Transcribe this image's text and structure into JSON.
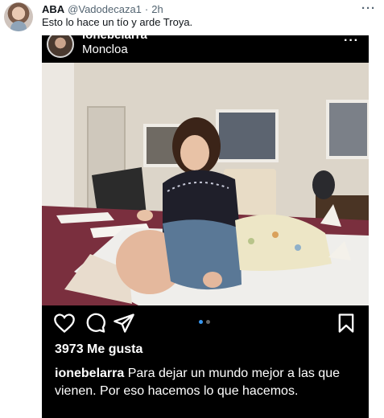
{
  "tweet": {
    "author_name": "ABA",
    "author_handle": "@Vadodecaza1",
    "separator": "·",
    "time": "2h",
    "more_glyph": "···",
    "text": "Esto lo hace un tío y arde Troya."
  },
  "instagram": {
    "username_cut": "ionebelarra",
    "location": "Moncloa",
    "more_glyph": "···",
    "likes": "3973 Me gusta",
    "caption_user": "ionebelarra",
    "caption_text": "Para dejar un mundo mejor a las que vienen. Por eso hacemos lo que hacemos.",
    "carousel": {
      "total": 2,
      "active": 1
    },
    "icons": [
      "heart-icon",
      "comment-icon",
      "share-icon",
      "bookmark-icon"
    ]
  },
  "colors": {
    "carousel_active": "#3897f0",
    "post_background": "#000000",
    "tablecloth": "#7a2f3e"
  }
}
